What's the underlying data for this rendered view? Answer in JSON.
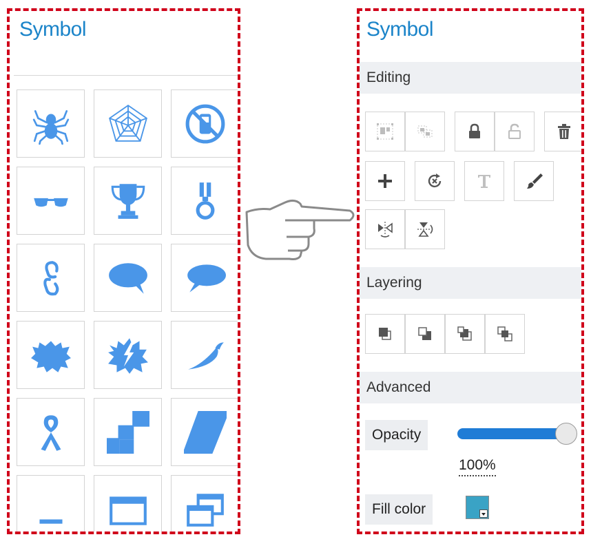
{
  "left_panel": {
    "title": "Symbol",
    "symbols": [
      {
        "icon": "spider-icon"
      },
      {
        "icon": "spiderweb-icon"
      },
      {
        "icon": "no-smoking-icon"
      },
      {
        "icon": "sunglasses-icon"
      },
      {
        "icon": "trophy-icon"
      },
      {
        "icon": "medal-icon"
      },
      {
        "icon": "chain-link-icon"
      },
      {
        "icon": "speech-bubble-right-icon"
      },
      {
        "icon": "speech-bubble-left-icon"
      },
      {
        "icon": "starburst-icon"
      },
      {
        "icon": "lightning-burst-icon"
      },
      {
        "icon": "chili-pepper-icon"
      },
      {
        "icon": "awareness-ribbon-icon"
      },
      {
        "icon": "checker-squares-icon"
      },
      {
        "icon": "parallelogram-icon"
      },
      {
        "icon": "minimize-window-icon"
      },
      {
        "icon": "maximize-window-icon"
      },
      {
        "icon": "restore-window-icon"
      }
    ]
  },
  "right_panel": {
    "title": "Symbol",
    "editing": {
      "label": "Editing",
      "tools": [
        "group-icon",
        "ungroup-icon",
        "lock-icon",
        "unlock-icon",
        "delete-icon",
        "add-icon",
        "reset-rotation-icon",
        "text-icon",
        "paint-brush-icon",
        "flip-horizontal-icon",
        "flip-vertical-icon"
      ]
    },
    "layering": {
      "label": "Layering",
      "tools": [
        "bring-to-front-icon",
        "send-to-back-icon",
        "bring-forward-icon",
        "send-backward-icon"
      ]
    },
    "advanced": {
      "label": "Advanced",
      "opacity_label": "Opacity",
      "opacity_value": "100%",
      "opacity_fraction": 1.0,
      "fill_color_label": "Fill color",
      "fill_color": "#3aa3c5"
    }
  },
  "colors": {
    "accent": "#1b84c9",
    "icon_blue": "#4a96e8",
    "dashed_border": "#d0021b",
    "slider": "#1f7cd6"
  }
}
